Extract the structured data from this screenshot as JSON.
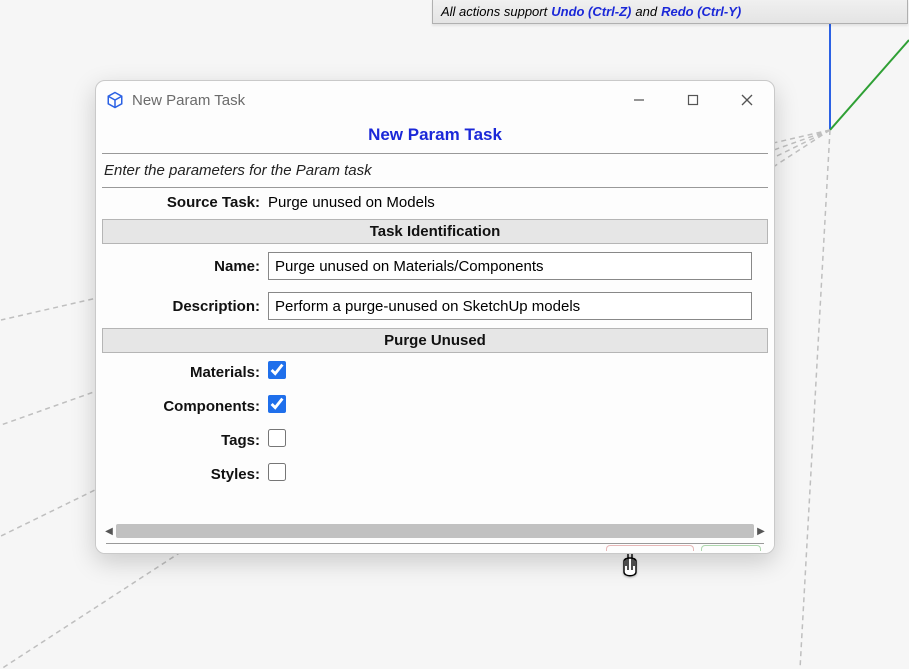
{
  "infobar": {
    "prefix": "All actions support ",
    "undo": "Undo (Ctrl-Z)",
    "mid": " and ",
    "redo": "Redo (Ctrl-Y)"
  },
  "dialog": {
    "window_title": "New Param Task",
    "heading": "New Param Task",
    "subheading": "Enter the parameters for the Param task",
    "source_task_label": "Source Task:",
    "source_task_value": "Purge unused on Models",
    "sections": {
      "identification": "Task Identification",
      "purge": "Purge Unused"
    },
    "fields": {
      "name_label": "Name:",
      "name_value": "Purge unused on Materials/Components",
      "description_label": "Description:",
      "description_value": "Perform a purge-unused on SketchUp models",
      "materials_label": "Materials:",
      "materials_checked": true,
      "components_label": "Components:",
      "components_checked": true,
      "tags_label": "Tags:",
      "tags_checked": false,
      "styles_label": "Styles:",
      "styles_checked": false
    }
  }
}
